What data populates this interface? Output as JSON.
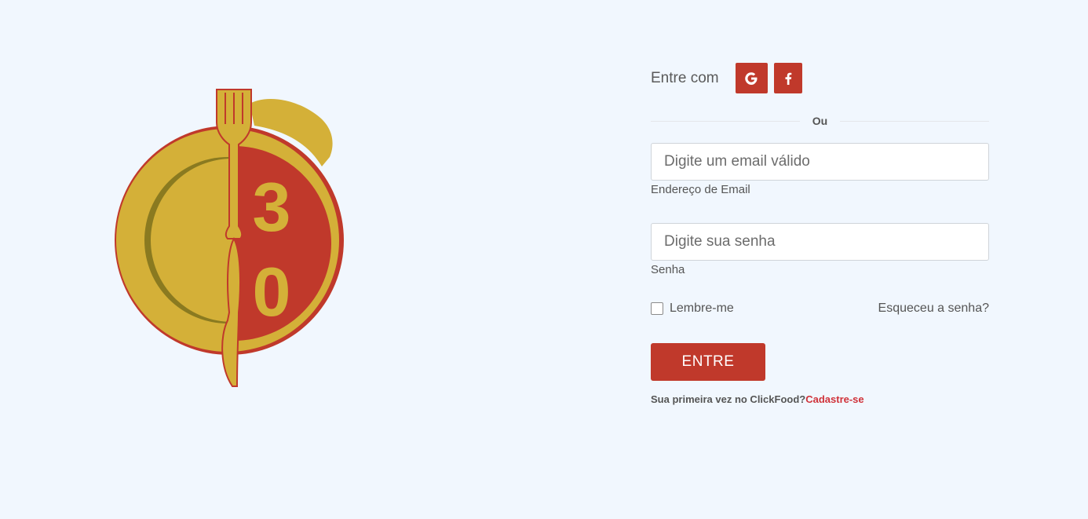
{
  "social": {
    "label": "Entre com",
    "google_icon": "G",
    "facebook_icon": "f"
  },
  "divider": {
    "text": "Ou"
  },
  "email": {
    "placeholder": "Digite um email válido",
    "label": "Endereço de Email"
  },
  "password": {
    "placeholder": "Digite sua senha",
    "label": "Senha"
  },
  "remember": {
    "label": "Lembre-me"
  },
  "forgot": {
    "label": "Esqueceu a senha?"
  },
  "submit": {
    "label": "ENTRE"
  },
  "signup": {
    "prompt": "Sua primeira vez no ClickFood?",
    "link": "Cadastre-se"
  },
  "logo": {
    "number": "30",
    "colors": {
      "red": "#c0392b",
      "gold": "#d4b038",
      "shadow": "#8a7a20"
    }
  },
  "colors": {
    "background": "#f1f7fe",
    "accent": "#c0392b",
    "link": "#d0323a"
  }
}
